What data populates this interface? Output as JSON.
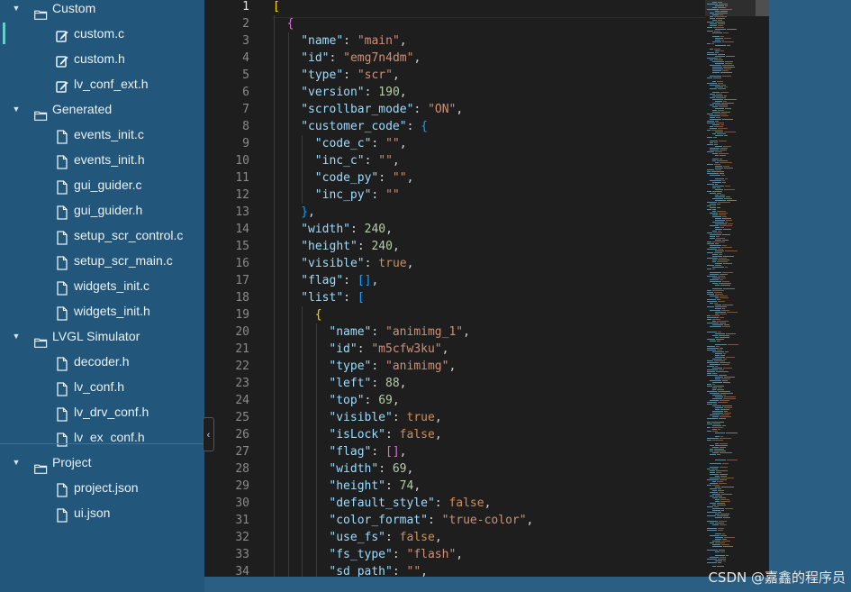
{
  "sidebar": {
    "tree": [
      {
        "kind": "folder",
        "label": "Custom",
        "name": "folder-custom"
      },
      {
        "kind": "file",
        "label": "custom.c",
        "name": "file-custom-c",
        "icon": "edit",
        "active": true
      },
      {
        "kind": "file",
        "label": "custom.h",
        "name": "file-custom-h",
        "icon": "edit"
      },
      {
        "kind": "file",
        "label": "lv_conf_ext.h",
        "name": "file-lv-conf-ext-h",
        "icon": "edit"
      },
      {
        "kind": "folder",
        "label": "Generated",
        "name": "folder-generated"
      },
      {
        "kind": "file",
        "label": "events_init.c",
        "name": "file-events-init-c",
        "icon": "file"
      },
      {
        "kind": "file",
        "label": "events_init.h",
        "name": "file-events-init-h",
        "icon": "file"
      },
      {
        "kind": "file",
        "label": "gui_guider.c",
        "name": "file-gui-guider-c",
        "icon": "file"
      },
      {
        "kind": "file",
        "label": "gui_guider.h",
        "name": "file-gui-guider-h",
        "icon": "file"
      },
      {
        "kind": "file",
        "label": "setup_scr_control.c",
        "name": "file-setup-scr-control-c",
        "icon": "file"
      },
      {
        "kind": "file",
        "label": "setup_scr_main.c",
        "name": "file-setup-scr-main-c",
        "icon": "file"
      },
      {
        "kind": "file",
        "label": "widgets_init.c",
        "name": "file-widgets-init-c",
        "icon": "file"
      },
      {
        "kind": "file",
        "label": "widgets_init.h",
        "name": "file-widgets-init-h",
        "icon": "file"
      },
      {
        "kind": "folder",
        "label": "LVGL Simulator",
        "name": "folder-lvgl-simulator"
      },
      {
        "kind": "file",
        "label": "decoder.h",
        "name": "file-decoder-h",
        "icon": "file"
      },
      {
        "kind": "file",
        "label": "lv_conf.h",
        "name": "file-lv-conf-h",
        "icon": "file"
      },
      {
        "kind": "file",
        "label": "lv_drv_conf.h",
        "name": "file-lv-drv-conf-h",
        "icon": "file"
      },
      {
        "kind": "file",
        "label": "lv_ex_conf.h",
        "name": "file-lv-ex-conf-h",
        "icon": "file"
      },
      {
        "kind": "folder",
        "label": "Project",
        "name": "folder-project"
      },
      {
        "kind": "file",
        "label": "project.json",
        "name": "file-project-json",
        "icon": "file"
      },
      {
        "kind": "file",
        "label": "ui.json",
        "name": "file-ui-json",
        "icon": "file"
      }
    ]
  },
  "editor": {
    "collapse_glyph": "‹",
    "current_line": 1,
    "lines": [
      {
        "n": "1",
        "indent": 0,
        "t": [
          [
            "br1",
            "["
          ]
        ]
      },
      {
        "n": "2",
        "indent": 1,
        "t": [
          [
            "br2",
            "{"
          ]
        ]
      },
      {
        "n": "3",
        "indent": 2,
        "t": [
          [
            "k",
            "\"name\""
          ],
          [
            "p",
            ": "
          ],
          [
            "s",
            "\"main\""
          ],
          [
            "p",
            ","
          ]
        ]
      },
      {
        "n": "4",
        "indent": 2,
        "t": [
          [
            "k",
            "\"id\""
          ],
          [
            "p",
            ": "
          ],
          [
            "s",
            "\"emg7n4dm\""
          ],
          [
            "p",
            ","
          ]
        ]
      },
      {
        "n": "5",
        "indent": 2,
        "t": [
          [
            "k",
            "\"type\""
          ],
          [
            "p",
            ": "
          ],
          [
            "s",
            "\"scr\""
          ],
          [
            "p",
            ","
          ]
        ]
      },
      {
        "n": "6",
        "indent": 2,
        "t": [
          [
            "k",
            "\"version\""
          ],
          [
            "p",
            ": "
          ],
          [
            "n",
            "190"
          ],
          [
            "p",
            ","
          ]
        ]
      },
      {
        "n": "7",
        "indent": 2,
        "t": [
          [
            "k",
            "\"scrollbar_mode\""
          ],
          [
            "p",
            ": "
          ],
          [
            "s",
            "\"ON\""
          ],
          [
            "p",
            ","
          ]
        ]
      },
      {
        "n": "8",
        "indent": 2,
        "t": [
          [
            "k",
            "\"customer_code\""
          ],
          [
            "p",
            ": "
          ],
          [
            "br3",
            "{"
          ]
        ]
      },
      {
        "n": "9",
        "indent": 3,
        "t": [
          [
            "k",
            "\"code_c\""
          ],
          [
            "p",
            ": "
          ],
          [
            "s",
            "\"\""
          ],
          [
            "p",
            ","
          ]
        ]
      },
      {
        "n": "10",
        "indent": 3,
        "t": [
          [
            "k",
            "\"inc_c\""
          ],
          [
            "p",
            ": "
          ],
          [
            "s",
            "\"\""
          ],
          [
            "p",
            ","
          ]
        ]
      },
      {
        "n": "11",
        "indent": 3,
        "t": [
          [
            "k",
            "\"code_py\""
          ],
          [
            "p",
            ": "
          ],
          [
            "s",
            "\"\""
          ],
          [
            "p",
            ","
          ]
        ]
      },
      {
        "n": "12",
        "indent": 3,
        "t": [
          [
            "k",
            "\"inc_py\""
          ],
          [
            "p",
            ": "
          ],
          [
            "s",
            "\"\""
          ]
        ]
      },
      {
        "n": "13",
        "indent": 2,
        "t": [
          [
            "br3",
            "}"
          ],
          [
            "p",
            ","
          ]
        ]
      },
      {
        "n": "14",
        "indent": 2,
        "t": [
          [
            "k",
            "\"width\""
          ],
          [
            "p",
            ": "
          ],
          [
            "n",
            "240"
          ],
          [
            "p",
            ","
          ]
        ]
      },
      {
        "n": "15",
        "indent": 2,
        "t": [
          [
            "k",
            "\"height\""
          ],
          [
            "p",
            ": "
          ],
          [
            "n",
            "240"
          ],
          [
            "p",
            ","
          ]
        ]
      },
      {
        "n": "16",
        "indent": 2,
        "t": [
          [
            "k",
            "\"visible\""
          ],
          [
            "p",
            ": "
          ],
          [
            "b",
            "true"
          ],
          [
            "p",
            ","
          ]
        ]
      },
      {
        "n": "17",
        "indent": 2,
        "t": [
          [
            "k",
            "\"flag\""
          ],
          [
            "p",
            ": "
          ],
          [
            "br3",
            "[]"
          ],
          [
            "p",
            ","
          ]
        ]
      },
      {
        "n": "18",
        "indent": 2,
        "t": [
          [
            "k",
            "\"list\""
          ],
          [
            "p",
            ": "
          ],
          [
            "br3",
            "["
          ]
        ]
      },
      {
        "n": "19",
        "indent": 3,
        "t": [
          [
            "br1",
            "{"
          ]
        ]
      },
      {
        "n": "20",
        "indent": 4,
        "t": [
          [
            "k",
            "\"name\""
          ],
          [
            "p",
            ": "
          ],
          [
            "s",
            "\"animimg_1\""
          ],
          [
            "p",
            ","
          ]
        ]
      },
      {
        "n": "21",
        "indent": 4,
        "t": [
          [
            "k",
            "\"id\""
          ],
          [
            "p",
            ": "
          ],
          [
            "s",
            "\"m5cfw3ku\""
          ],
          [
            "p",
            ","
          ]
        ]
      },
      {
        "n": "22",
        "indent": 4,
        "t": [
          [
            "k",
            "\"type\""
          ],
          [
            "p",
            ": "
          ],
          [
            "s",
            "\"animimg\""
          ],
          [
            "p",
            ","
          ]
        ]
      },
      {
        "n": "23",
        "indent": 4,
        "t": [
          [
            "k",
            "\"left\""
          ],
          [
            "p",
            ": "
          ],
          [
            "n",
            "88"
          ],
          [
            "p",
            ","
          ]
        ]
      },
      {
        "n": "24",
        "indent": 4,
        "t": [
          [
            "k",
            "\"top\""
          ],
          [
            "p",
            ": "
          ],
          [
            "n",
            "69"
          ],
          [
            "p",
            ","
          ]
        ]
      },
      {
        "n": "25",
        "indent": 4,
        "t": [
          [
            "k",
            "\"visible\""
          ],
          [
            "p",
            ": "
          ],
          [
            "b",
            "true"
          ],
          [
            "p",
            ","
          ]
        ]
      },
      {
        "n": "26",
        "indent": 4,
        "t": [
          [
            "k",
            "\"isLock\""
          ],
          [
            "p",
            ": "
          ],
          [
            "b",
            "false"
          ],
          [
            "p",
            ","
          ]
        ]
      },
      {
        "n": "27",
        "indent": 4,
        "t": [
          [
            "k",
            "\"flag\""
          ],
          [
            "p",
            ": "
          ],
          [
            "br2",
            "[]"
          ],
          [
            "p",
            ","
          ]
        ]
      },
      {
        "n": "28",
        "indent": 4,
        "t": [
          [
            "k",
            "\"width\""
          ],
          [
            "p",
            ": "
          ],
          [
            "n",
            "69"
          ],
          [
            "p",
            ","
          ]
        ]
      },
      {
        "n": "29",
        "indent": 4,
        "t": [
          [
            "k",
            "\"height\""
          ],
          [
            "p",
            ": "
          ],
          [
            "n",
            "74"
          ],
          [
            "p",
            ","
          ]
        ]
      },
      {
        "n": "30",
        "indent": 4,
        "t": [
          [
            "k",
            "\"default_style\""
          ],
          [
            "p",
            ": "
          ],
          [
            "b",
            "false"
          ],
          [
            "p",
            ","
          ]
        ]
      },
      {
        "n": "31",
        "indent": 4,
        "t": [
          [
            "k",
            "\"color_format\""
          ],
          [
            "p",
            ": "
          ],
          [
            "s",
            "\"true-color\""
          ],
          [
            "p",
            ","
          ]
        ]
      },
      {
        "n": "32",
        "indent": 4,
        "t": [
          [
            "k",
            "\"use_fs\""
          ],
          [
            "p",
            ": "
          ],
          [
            "b",
            "false"
          ],
          [
            "p",
            ","
          ]
        ]
      },
      {
        "n": "33",
        "indent": 4,
        "t": [
          [
            "k",
            "\"fs_type\""
          ],
          [
            "p",
            ": "
          ],
          [
            "s",
            "\"flash\""
          ],
          [
            "p",
            ","
          ]
        ]
      },
      {
        "n": "34",
        "indent": 4,
        "t": [
          [
            "k",
            "\"sd_path\""
          ],
          [
            "p",
            ": "
          ],
          [
            "s",
            "\"\""
          ],
          [
            "p",
            ","
          ]
        ]
      }
    ]
  },
  "colors": {
    "sidebar_bg": "#22567a",
    "editor_bg": "#1e1e1e",
    "key": "#9cdcfe",
    "string": "#ce9178",
    "number": "#b5cea8",
    "active_marker": "#4ee0b5"
  },
  "watermark": "CSDN @嘉鑫的程序员"
}
